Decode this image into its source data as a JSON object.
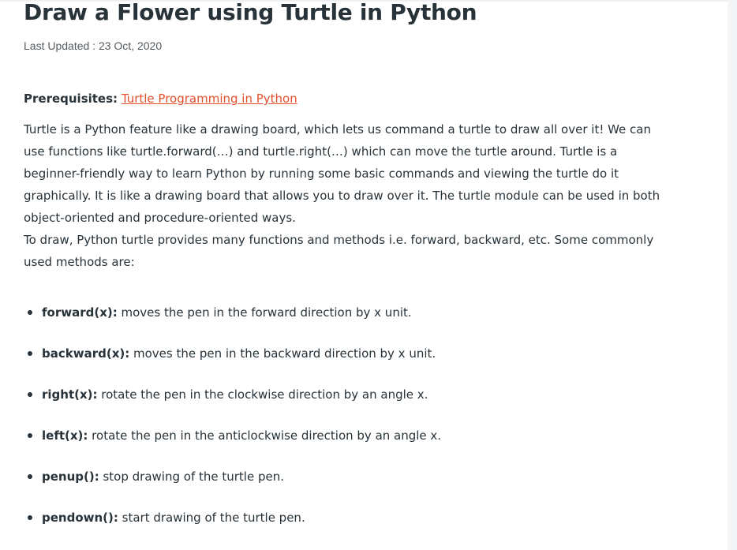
{
  "article": {
    "title": "Draw a Flower using Turtle in Python",
    "last_updated": "Last Updated : 23 Oct, 2020",
    "prerequisites_label": "Prerequisites:",
    "prerequisites_link": "Turtle Programming in Python",
    "intro_paragraph": "Turtle is a Python feature like a drawing board, which lets us command a turtle to draw all over it! We can use functions like turtle.forward(…) and turtle.right(…) which can move the turtle around. Turtle is a beginner-friendly way to learn Python by running some basic commands and viewing the turtle do it graphically. It is like a drawing board that allows you to draw over it. The turtle module can be used in both object-oriented and procedure-oriented ways.",
    "methods_intro": "To draw, Python turtle provides many functions and methods i.e. forward, backward, etc. Some commonly used methods are:",
    "methods": [
      {
        "name": "forward(x):",
        "desc": " moves the pen in the forward direction by x unit."
      },
      {
        "name": "backward(x):",
        "desc": " moves the pen in the backward direction by x unit."
      },
      {
        "name": "right(x):",
        "desc": " rotate the pen in the clockwise direction by an angle x."
      },
      {
        "name": "left(x):",
        "desc": " rotate the pen in the anticlockwise direction by an angle x."
      },
      {
        "name": "penup():",
        "desc": " stop drawing of the turtle pen."
      },
      {
        "name": "pendown():",
        "desc": " start drawing of the turtle pen."
      }
    ]
  },
  "colors": {
    "text": "#273239",
    "link": "#e2502c",
    "meta": "#555b60",
    "background": "#ffffff"
  }
}
